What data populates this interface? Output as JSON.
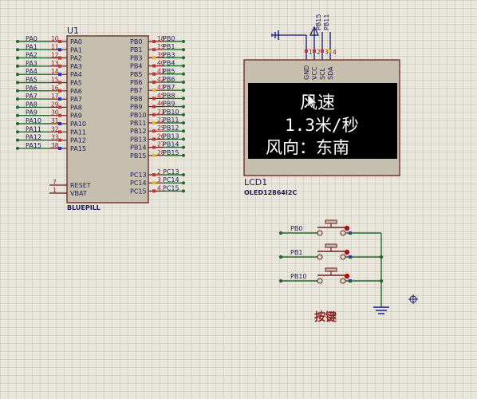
{
  "mcu": {
    "ref": "U1",
    "name": "BLUEPILL",
    "left_pins": [
      {
        "net": "PA0",
        "num": "10",
        "name": "PA0"
      },
      {
        "net": "PA1",
        "num": "11",
        "name": "PA1"
      },
      {
        "net": "PA2",
        "num": "12",
        "name": "PA2"
      },
      {
        "net": "PA3",
        "num": "13",
        "name": "PA3"
      },
      {
        "net": "PA4",
        "num": "14",
        "name": "PA4"
      },
      {
        "net": "PA5",
        "num": "15",
        "name": "PA5"
      },
      {
        "net": "PA6",
        "num": "16",
        "name": "PA6"
      },
      {
        "net": "PA7",
        "num": "17",
        "name": "PA7"
      },
      {
        "net": "PA8",
        "num": "29",
        "name": "PA8"
      },
      {
        "net": "PA9",
        "num": "30",
        "name": "PA9"
      },
      {
        "net": "PA10",
        "num": "31",
        "name": "PA10"
      },
      {
        "net": "PA11",
        "num": "32",
        "name": "PA11"
      },
      {
        "net": "PA12",
        "num": "33",
        "name": "PA12"
      },
      {
        "net": "PA15",
        "num": "38",
        "name": "PA15"
      }
    ],
    "left_bottom_pins": [
      {
        "num": "7",
        "name": "RESET"
      },
      {
        "num": "1",
        "name": "VBAT"
      }
    ],
    "right_pins": [
      {
        "name": "PB0",
        "num": "18",
        "net": "PB0"
      },
      {
        "name": "PB1",
        "num": "19",
        "net": "PB1"
      },
      {
        "name": "PB3",
        "num": "39",
        "net": "PB3"
      },
      {
        "name": "PB4",
        "num": "40",
        "net": "PB4"
      },
      {
        "name": "PB5",
        "num": "41",
        "net": "PB5"
      },
      {
        "name": "PB6",
        "num": "42",
        "net": "PB6"
      },
      {
        "name": "PB7",
        "num": "43",
        "net": "PB7"
      },
      {
        "name": "PB8",
        "num": "45",
        "net": "PB8"
      },
      {
        "name": "PB9",
        "num": "46",
        "net": "PB9"
      },
      {
        "name": "PB10",
        "num": "21",
        "net": "PB10"
      },
      {
        "name": "PB11",
        "num": "22",
        "net": "PB11"
      },
      {
        "name": "PB12",
        "num": "25",
        "net": "PB12"
      },
      {
        "name": "PB13",
        "num": "26",
        "net": "PB13"
      },
      {
        "name": "PB14",
        "num": "27",
        "net": "PB14"
      },
      {
        "name": "PB15",
        "num": "28",
        "net": "PB15"
      }
    ],
    "right_bottom_pins": [
      {
        "name": "PC13",
        "num": "2",
        "net": "PC13"
      },
      {
        "name": "PC14",
        "num": "3",
        "net": "PC14"
      },
      {
        "name": "PC15",
        "num": "4",
        "net": "PC15"
      }
    ]
  },
  "lcd": {
    "ref": "LCD1",
    "model": "OLED12864I2C",
    "pins": [
      "GND",
      "VCC",
      "SCL",
      "SDA"
    ],
    "pin_numbers": [
      "1",
      "2",
      "3",
      "4"
    ],
    "nets": [
      "PB15",
      "PB11"
    ],
    "display": {
      "line1": "风速",
      "line2": "1.3米/秒",
      "line3": "风向：东南"
    }
  },
  "buttons": {
    "caption": "按键",
    "nets": [
      "PB0",
      "PB1",
      "PB10"
    ]
  },
  "colors": {
    "background": "#e9e7dd",
    "component_fill": "#c7bfad",
    "wire": "#1d6b2a",
    "screen": "#000000",
    "caption": "#8a1b1b"
  }
}
